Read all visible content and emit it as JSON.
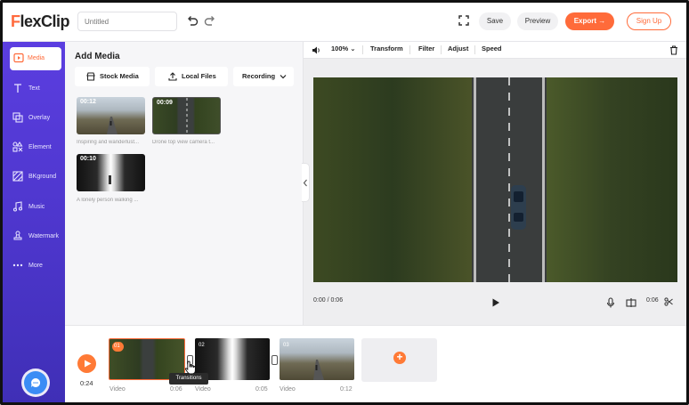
{
  "app": {
    "logo_first": "F",
    "logo_rest": "lexClip",
    "title_placeholder": "Untitled"
  },
  "header": {
    "save_label": "Save",
    "preview_label": "Preview",
    "export_label": "Export",
    "signup_label": "Sign Up"
  },
  "sidebar": {
    "items": [
      {
        "label": "Media",
        "icon": "media-icon"
      },
      {
        "label": "Text",
        "icon": "text-icon"
      },
      {
        "label": "Overlay",
        "icon": "overlay-icon"
      },
      {
        "label": "Element",
        "icon": "element-icon"
      },
      {
        "label": "BKground",
        "icon": "background-icon"
      },
      {
        "label": "Music",
        "icon": "music-icon"
      },
      {
        "label": "Watermark",
        "icon": "watermark-icon"
      },
      {
        "label": "More",
        "icon": "more-icon"
      }
    ],
    "active": "Media"
  },
  "media": {
    "title": "Add Media",
    "stock_label": "Stock Media",
    "local_label": "Local Files",
    "recording_label": "Recording",
    "items": [
      {
        "duration": "00:12",
        "caption": "Inspiring and wanderlust..."
      },
      {
        "duration": "00:09",
        "caption": "Drone top view camera t..."
      },
      {
        "duration": "00:10",
        "caption": "A lonely person walking ..."
      }
    ]
  },
  "preview": {
    "zoom": "100%",
    "tools": [
      "Transform",
      "Filter",
      "Adjust",
      "Speed"
    ],
    "time_current": "0:00 / 0:06",
    "time_total": "0:06"
  },
  "timeline": {
    "total_time": "0:24",
    "tooltip": "Transitions",
    "clips": [
      {
        "number": "01",
        "label": "Video",
        "duration": "0:06"
      },
      {
        "number": "02",
        "label": "Video",
        "duration": "0:05"
      },
      {
        "number": "03",
        "label": "Video",
        "duration": "0:12"
      }
    ]
  },
  "colors": {
    "accent": "#ff6b3a",
    "sidebar": "#4b35c9"
  }
}
